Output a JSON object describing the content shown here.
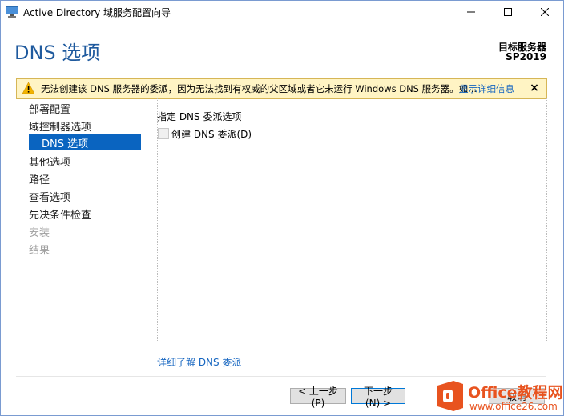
{
  "window": {
    "title": "Active Directory 域服务配置向导",
    "min_glyph": "—",
    "max_glyph": "☐",
    "close_glyph": "✕"
  },
  "header": {
    "page_title": "DNS 选项",
    "target_label": "目标服务器",
    "target_name": "SP2019"
  },
  "warning": {
    "text": "无法创建该 DNS 服务器的委派，因为无法找到有权威的父区域或者它未运行 Windows DNS 服务器。如...",
    "link": "显示详细信息",
    "close": "×"
  },
  "nav": {
    "items": [
      {
        "label": "部署配置",
        "enabled": true
      },
      {
        "label": "域控制器选项",
        "enabled": true
      },
      {
        "label": "DNS 选项",
        "enabled": true,
        "selected": true
      },
      {
        "label": "其他选项",
        "enabled": true
      },
      {
        "label": "路径",
        "enabled": true
      },
      {
        "label": "查看选项",
        "enabled": true
      },
      {
        "label": "先决条件检查",
        "enabled": true
      },
      {
        "label": "安装",
        "enabled": false
      },
      {
        "label": "结果",
        "enabled": false
      }
    ]
  },
  "content": {
    "section_label": "指定 DNS 委派选项",
    "checkbox_label": "创建 DNS 委派(D)",
    "checkbox_checked": false,
    "learn_more": "详细了解 DNS 委派"
  },
  "buttons": {
    "prev": "< 上一步(P)",
    "next": "下一步(N) >",
    "cancel": "取消"
  },
  "watermark": {
    "brand": "Office教程网",
    "url": "www.office26.com"
  },
  "colors": {
    "accent": "#0a64c0",
    "title": "#1f5a9e",
    "link": "#1565c0",
    "warning_bg": "#fff4c4",
    "watermark_orange": "#e8531f"
  }
}
